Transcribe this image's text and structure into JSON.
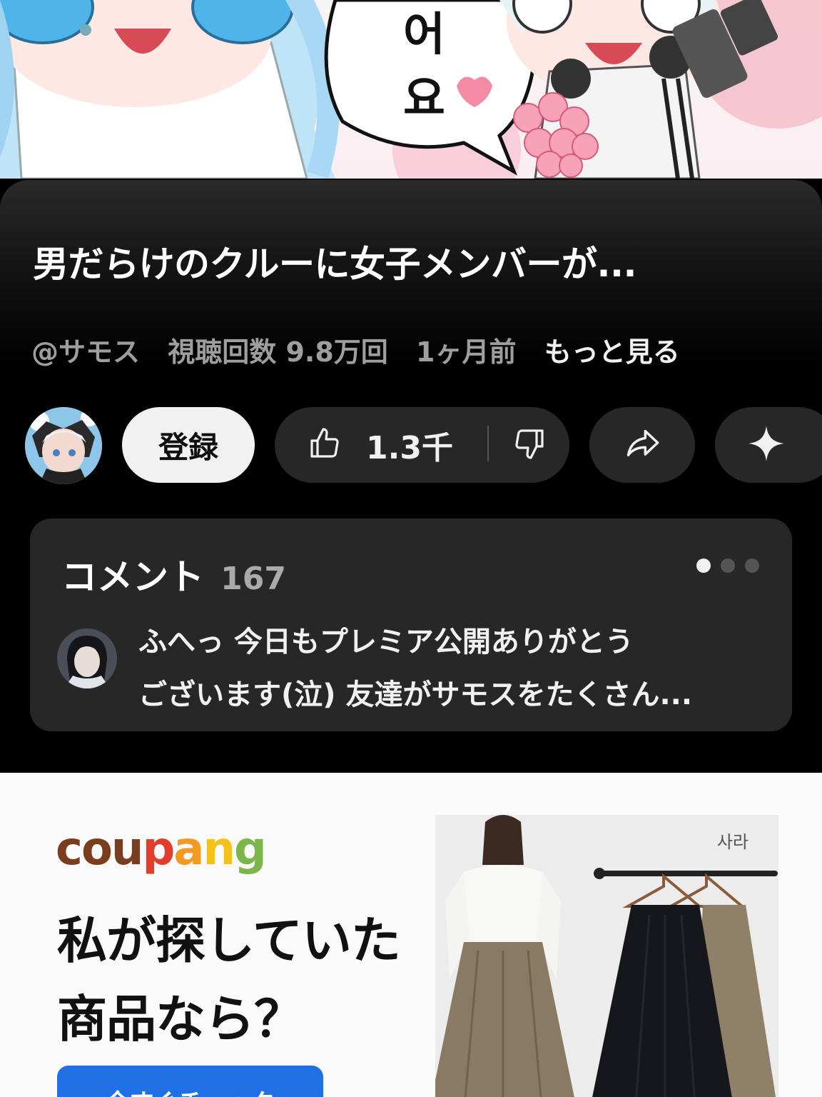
{
  "thumbnail": {
    "bubble_text_line1": "어",
    "bubble_text_line2": "요"
  },
  "video": {
    "title": "男だらけのクルーに女子メンバーが...",
    "channel": "@サモス",
    "views": "視聴回数 9.8万回",
    "age": "1ヶ月前",
    "more_label": "もっと見る"
  },
  "actions": {
    "subscribe_label": "登録",
    "like_count": "1.3千",
    "icons": [
      "thumbs-up-icon",
      "thumbs-down-icon",
      "share-icon",
      "sparkle-icon"
    ]
  },
  "comments": {
    "title": "コメント",
    "count": "167",
    "pager": {
      "total": 3,
      "active": 0
    },
    "top_comment": {
      "line1": "ふへっ 今日もプレミア公開ありがとう",
      "line2": "ございます(泣) 友達がサモスをたくさん..."
    }
  },
  "ad": {
    "brand_logo": "coupang",
    "headline_line1": "私が探していた",
    "headline_line2": "商品なら？",
    "cta_label": "今すぐチェック",
    "product_brand": "사라"
  },
  "colors": {
    "background": "#000000",
    "pill": "#272727",
    "subscribe_bg": "#f1f1f1",
    "cta_blue": "#1f6fe5",
    "ad_background": "#fafafa"
  }
}
